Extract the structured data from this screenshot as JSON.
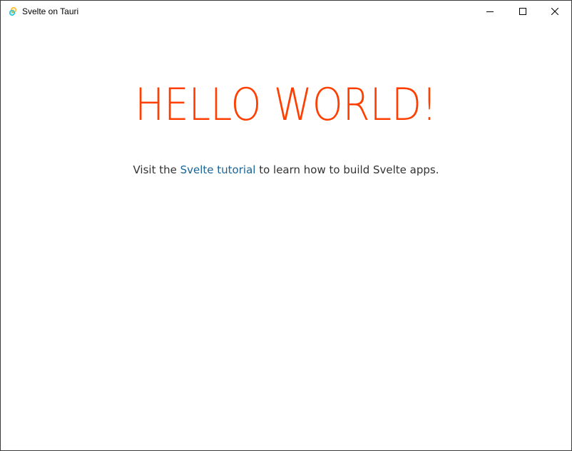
{
  "window": {
    "title": "Svelte on Tauri",
    "icon": "tauri-app-icon",
    "controls": {
      "minimize_icon": "minimize-icon",
      "maximize_icon": "maximize-icon",
      "close_icon": "close-icon"
    }
  },
  "main": {
    "heading": "HELLO WORLD!",
    "paragraph": {
      "prefix": "Visit the ",
      "link_text": "Svelte tutorial",
      "suffix": " to learn how to build Svelte apps."
    }
  },
  "colors": {
    "heading": "#ff3e00",
    "link": "#1a6496",
    "text": "#333333"
  }
}
